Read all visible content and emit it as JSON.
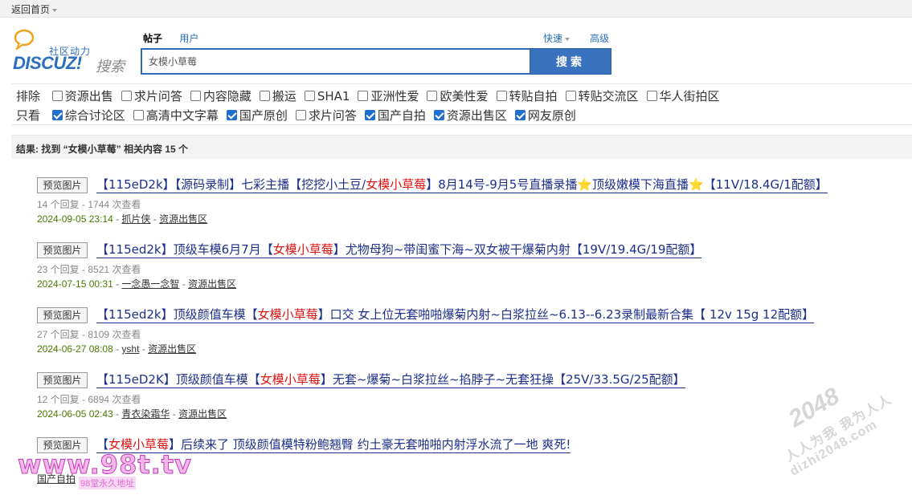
{
  "topbar": {
    "back_label": "返回首页"
  },
  "logo": {
    "tag": "社区动力",
    "word": "DISCUZ!",
    "sub": "搜索"
  },
  "search": {
    "tab_posts": "帖子",
    "tab_users": "用户",
    "quick": "快速",
    "advanced": "高级",
    "value": "女模小草莓",
    "button": "搜索"
  },
  "filter": {
    "exclude_label": "排除",
    "exclude": [
      {
        "label": "资源出售",
        "checked": false
      },
      {
        "label": "求片问答",
        "checked": false
      },
      {
        "label": "内容隐藏",
        "checked": false
      },
      {
        "label": "搬运",
        "checked": false
      },
      {
        "label": "SHA1",
        "checked": false
      },
      {
        "label": "亚洲性爱",
        "checked": false
      },
      {
        "label": "欧美性爱",
        "checked": false
      },
      {
        "label": "转贴自拍",
        "checked": false
      },
      {
        "label": "转贴交流区",
        "checked": false
      },
      {
        "label": "华人街拍区",
        "checked": false
      }
    ],
    "only_label": "只看",
    "only": [
      {
        "label": "综合讨论区",
        "checked": true
      },
      {
        "label": "高清中文字幕",
        "checked": false
      },
      {
        "label": "国产原创",
        "checked": true
      },
      {
        "label": "求片问答",
        "checked": false
      },
      {
        "label": "国产自拍",
        "checked": true
      },
      {
        "label": "资源出售区",
        "checked": true
      },
      {
        "label": "网友原创",
        "checked": true
      }
    ]
  },
  "result": {
    "text": "结果: 找到 “女模小草莓” 相关内容 15 个"
  },
  "preview_label": "预览图片",
  "items": [
    {
      "title_pre": "【115eD2k】【源码录制】七彩主播【挖挖小土豆/",
      "title_hl": "女模小草莓",
      "title_post": "】8月14号-9月5号直播录播",
      "title_star": "⭐",
      "title_mid": "顶级嫩模下海直播",
      "title_star2": "⭐",
      "title_end": "【11V/18.4G/1配额】",
      "meta": "14 个回复 - 1744 次查看",
      "date": "2024-09-05 23:14",
      "author": "抓片侠",
      "forum": "资源出售区"
    },
    {
      "title_pre": "【115ed2k】顶级车模6月7月【",
      "title_hl": "女模小草莓",
      "title_post": "】尤物母狗~带闺蜜下海~双女被干爆菊内射【19V/19.4G/19配额】",
      "meta": "23 个回复 - 8521 次查看",
      "date": "2024-07-15 00:31",
      "author": "一念愚一念智",
      "forum": "资源出售区"
    },
    {
      "title_pre": "【115ed2k】顶级颜值车模【",
      "title_hl": "女模小草莓",
      "title_post": "】口交 女上位无套啪啪爆菊内射~白浆拉丝~6.13--6.23录制最新合集【 12v 15g 12配额】",
      "meta": "27 个回复 - 8109 次查看",
      "date": "2024-06-27 08:08",
      "author": "ysht",
      "forum": "资源出售区"
    },
    {
      "title_pre": "【115eD2K】顶级颜值车模【",
      "title_hl": "女模小草莓",
      "title_post": "】无套~爆菊~白浆拉丝~掐脖子~无套狂操【25V/33.5G/25配额】",
      "meta": "12 个回复 - 6894 次查看",
      "date": "2024-06-05 02:43",
      "author": "青衣染霜华",
      "forum": "资源出售区"
    },
    {
      "title_pre": "【",
      "title_hl": "女模小草莓",
      "title_post": "】后续来了 顶级颜值模特粉鲍翘臀 约土豪无套啪啪内射浮水流了一地 爽死!",
      "forum": "国产自拍"
    }
  ],
  "watermarks": {
    "wm98_big": "www.98t.tv",
    "wm98_small": "98堂永久地址",
    "wm2048_num": "2048",
    "wm2048_slogan": "人人为我 我为人人",
    "wm2048_url": "dizhi2048.com"
  }
}
